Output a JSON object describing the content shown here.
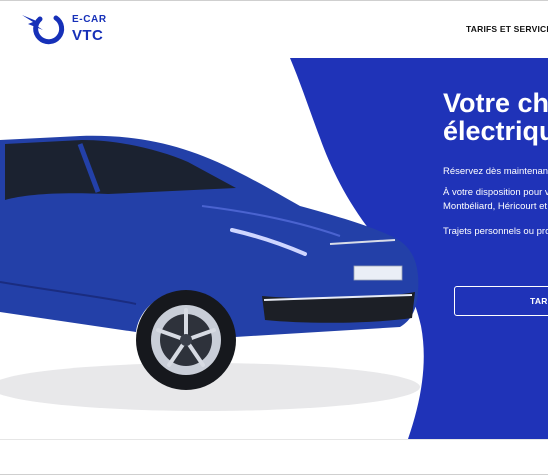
{
  "header": {
    "logo": {
      "line1": "E-CAR",
      "line2": "VTC"
    },
    "nav": {
      "link1": "TARIFS ET SERVICES"
    }
  },
  "hero": {
    "title_line1": "Votre chauffeur",
    "title_line2": "électrique",
    "text1": "Réservez dès maintenant",
    "text2_line1": "À votre disposition pour vos trajets à",
    "text2_line2": "Montbéliard, Héricourt et environs",
    "text3": "Trajets personnels ou professionnels",
    "cta": "TARIFS",
    "car_image": "blue electric SUV",
    "license_plate_text": ""
  },
  "colors": {
    "brand_blue": "#1630b8",
    "hero_blue": "#1f33b8",
    "car_body": "#2340a8",
    "text_dark": "#111111",
    "white": "#ffffff"
  },
  "icons": {
    "logo_mark": "bolt-ring-icon"
  }
}
